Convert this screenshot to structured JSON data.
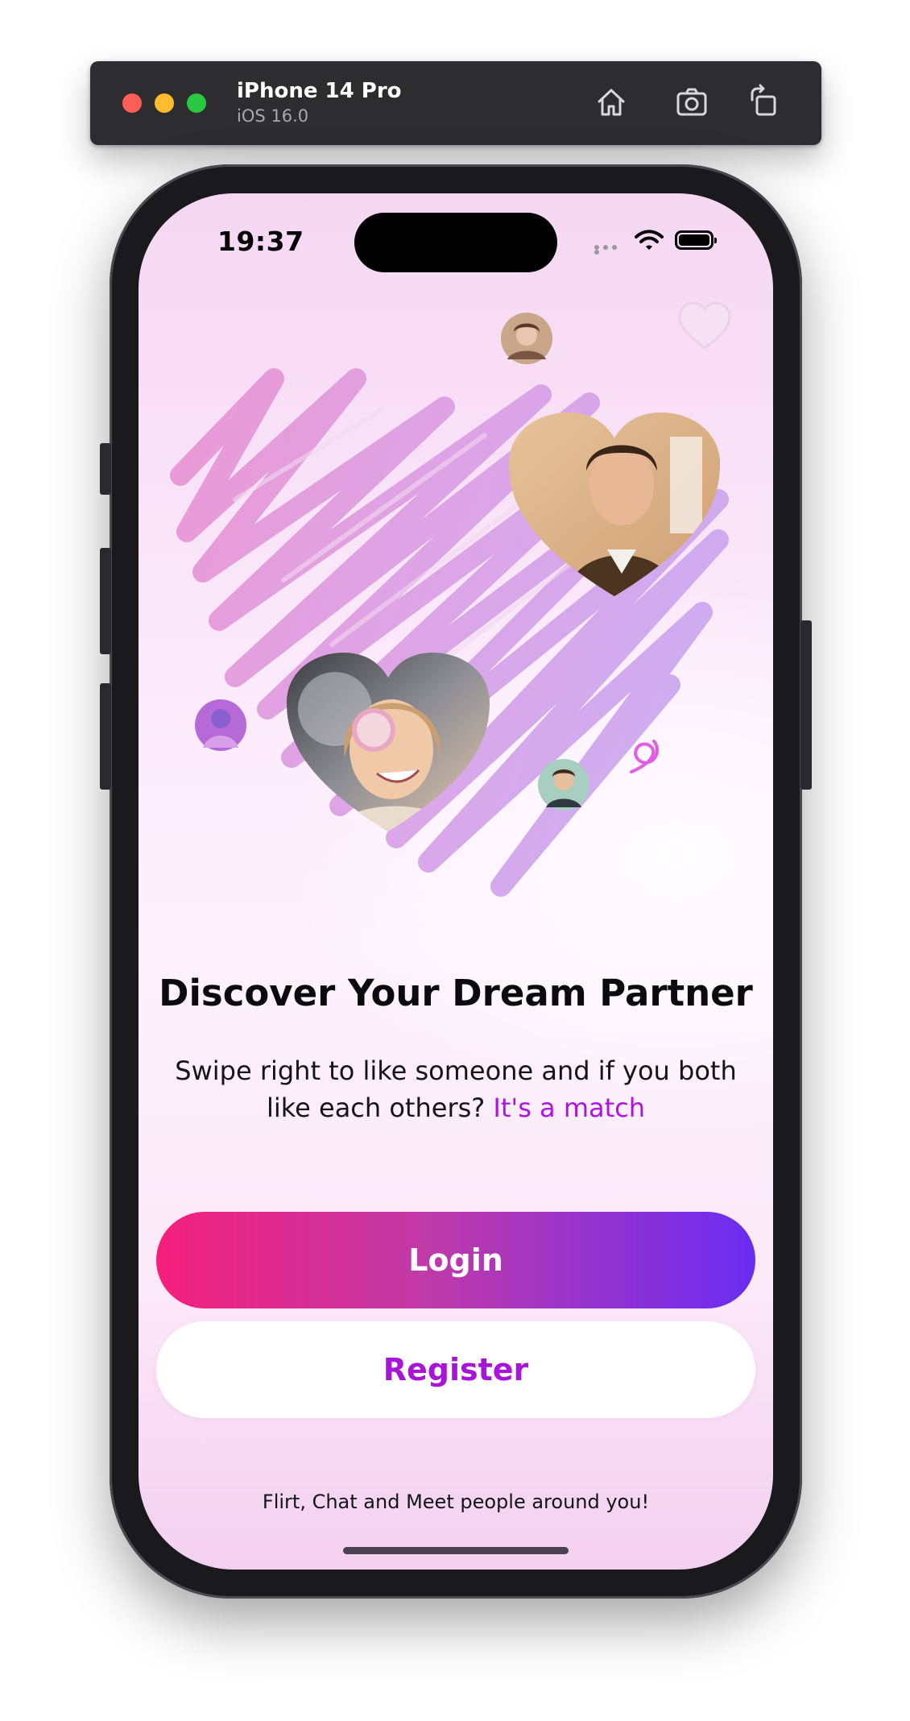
{
  "simulator": {
    "device_name": "iPhone 14 Pro",
    "os_version": "iOS 16.0",
    "icons": [
      "home-icon",
      "screenshot-icon",
      "rotate-icon"
    ]
  },
  "status_bar": {
    "time": "19:37",
    "icons": [
      "signal-dots-icon",
      "wifi-icon",
      "battery-icon"
    ]
  },
  "onboarding": {
    "headline": "Discover Your Dream Partner",
    "subtext": "Swipe right to like someone and if you both like each others?",
    "highlight": "It's a match",
    "login_label": "Login",
    "register_label": "Register",
    "tagline": "Flirt, Chat and Meet people around you!"
  },
  "colors": {
    "accent_pink": "#f5207a",
    "accent_purple": "#6a2cf2",
    "highlight": "#b012e0"
  }
}
